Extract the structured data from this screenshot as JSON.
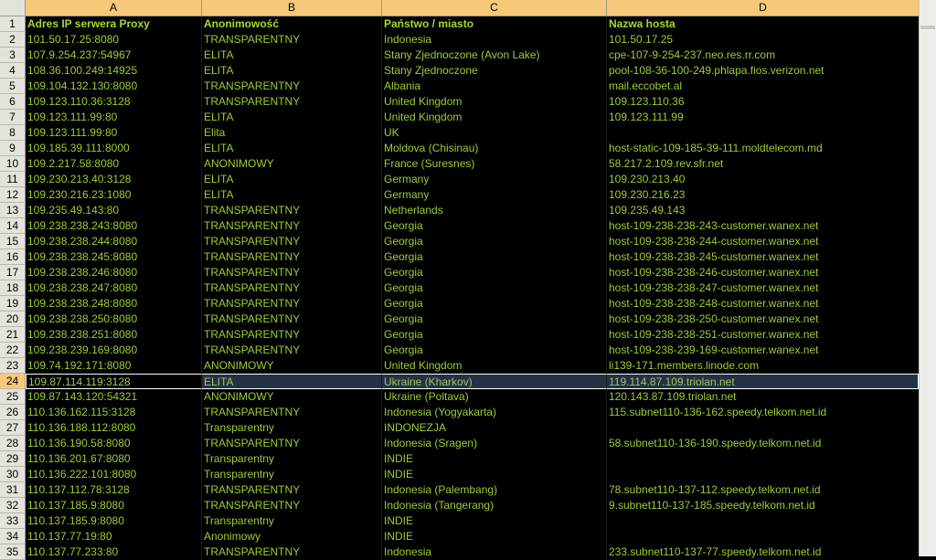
{
  "columns": [
    "A",
    "B",
    "C",
    "D"
  ],
  "header": {
    "a": "Adres IP serwera Proxy",
    "b": "Anonimowość",
    "c": "Państwo / miasto",
    "d": "Nazwa hosta"
  },
  "rows": [
    {
      "n": "2",
      "a": "101.50.17.25:8080",
      "b": "TRANSPARENTNY",
      "c": "Indonesia",
      "d": "101.50.17.25"
    },
    {
      "n": "3",
      "a": "107.9.254.237:54967",
      "b": "ELITA",
      "c": "Stany Zjednoczone (Avon Lake)",
      "d": "cpe-107-9-254-237.neo.res.rr.com"
    },
    {
      "n": "4",
      "a": "108.36.100.249:14925",
      "b": "ELITA",
      "c": "Stany Zjednoczone",
      "d": "pool-108-36-100-249.phlapa.fios.verizon.net"
    },
    {
      "n": "5",
      "a": "109.104.132.130:8080",
      "b": "TRANSPARENTNY",
      "c": "Albania",
      "d": "mail.eccobet.al"
    },
    {
      "n": "6",
      "a": "109.123.110.36:3128",
      "b": "TRANSPARENTNY",
      "c": "United Kingdom",
      "d": "109.123.110.36"
    },
    {
      "n": "7",
      "a": "109.123.111.99:80",
      "b": "ELITA",
      "c": "United Kingdom",
      "d": "109.123.111.99"
    },
    {
      "n": "8",
      "a": "109.123.111.99:80",
      "b": "Elita",
      "c": "UK",
      "d": ""
    },
    {
      "n": "9",
      "a": "109.185.39.111:8000",
      "b": "ELITA",
      "c": "Moldova (Chisinau)",
      "d": "host-static-109-185-39-111.moldtelecom.md"
    },
    {
      "n": "10",
      "a": "109.2.217.58:8080",
      "b": "ANONIMOWY",
      "c": "France (Suresnes)",
      "d": "58.217.2.109.rev.sfr.net"
    },
    {
      "n": "11",
      "a": "109.230.213.40:3128",
      "b": "ELITA",
      "c": "Germany",
      "d": "109.230.213.40"
    },
    {
      "n": "12",
      "a": "109.230.216.23:1080",
      "b": "ELITA",
      "c": "Germany",
      "d": "109.230.216.23"
    },
    {
      "n": "13",
      "a": "109.235.49.143:80",
      "b": "TRANSPARENTNY",
      "c": "Netherlands",
      "d": "109.235.49.143"
    },
    {
      "n": "14",
      "a": "109.238.238.243:8080",
      "b": "TRANSPARENTNY",
      "c": "Georgia",
      "d": "host-109-238-238-243-customer.wanex.net"
    },
    {
      "n": "15",
      "a": "109.238.238.244:8080",
      "b": "TRANSPARENTNY",
      "c": "Georgia",
      "d": "host-109-238-238-244-customer.wanex.net"
    },
    {
      "n": "16",
      "a": "109.238.238.245:8080",
      "b": "TRANSPARENTNY",
      "c": "Georgia",
      "d": "host-109-238-238-245-customer.wanex.net"
    },
    {
      "n": "17",
      "a": "109.238.238.246:8080",
      "b": "TRANSPARENTNY",
      "c": "Georgia",
      "d": "host-109-238-238-246-customer.wanex.net"
    },
    {
      "n": "18",
      "a": "109.238.238.247:8080",
      "b": "TRANSPARENTNY",
      "c": "Georgia",
      "d": "host-109-238-238-247-customer.wanex.net"
    },
    {
      "n": "19",
      "a": "109.238.238.248:8080",
      "b": "TRANSPARENTNY",
      "c": "Georgia",
      "d": "host-109-238-238-248-customer.wanex.net"
    },
    {
      "n": "20",
      "a": "109.238.238.250:8080",
      "b": "TRANSPARENTNY",
      "c": "Georgia",
      "d": "host-109-238-238-250-customer.wanex.net"
    },
    {
      "n": "21",
      "a": "109.238.238.251:8080",
      "b": "TRANSPARENTNY",
      "c": "Georgia",
      "d": "host-109-238-238-251-customer.wanex.net"
    },
    {
      "n": "22",
      "a": "109.238.239.169:8080",
      "b": "TRANSPARENTNY",
      "c": "Georgia",
      "d": "host-109-238-239-169-customer.wanex.net"
    },
    {
      "n": "23",
      "a": "109.74.192.171:8080",
      "b": "ANONIMOWY",
      "c": "United Kingdom",
      "d": "li139-171.members.linode.com"
    },
    {
      "n": "24",
      "a": "109.87.114.119:3128",
      "b": "ELITA",
      "c": "Ukraine (Kharkov)",
      "d": "119.114.87.109.triolan.net",
      "selected": true
    },
    {
      "n": "25",
      "a": "109.87.143.120:54321",
      "b": "ANONIMOWY",
      "c": "Ukraine (Poltava)",
      "d": "120.143.87.109.triolan.net"
    },
    {
      "n": "26",
      "a": "110.136.162.115:3128",
      "b": "TRANSPARENTNY",
      "c": "Indonesia (Yogyakarta)",
      "d": "115.subnet110-136-162.speedy.telkom.net.id"
    },
    {
      "n": "27",
      "a": "110.136.188.112:8080",
      "b": "Transparentny",
      "c": "INDONEZJA",
      "d": ""
    },
    {
      "n": "28",
      "a": "110.136.190.58:8080",
      "b": "TRANSPARENTNY",
      "c": "Indonesia (Sragen)",
      "d": "58.subnet110-136-190.speedy.telkom.net.id"
    },
    {
      "n": "29",
      "a": "110.136.201.67:8080",
      "b": "Transparentny",
      "c": "INDIE",
      "d": ""
    },
    {
      "n": "30",
      "a": "110.136.222.101:8080",
      "b": "Transparentny",
      "c": "INDIE",
      "d": ""
    },
    {
      "n": "31",
      "a": "110.137.112.78:3128",
      "b": "TRANSPARENTNY",
      "c": "Indonesia (Palembang)",
      "d": "78.subnet110-137-112.speedy.telkom.net.id"
    },
    {
      "n": "32",
      "a": "110.137.185.9:8080",
      "b": "TRANSPARENTNY",
      "c": "Indonesia (Tangerang)",
      "d": "9.subnet110-137-185.speedy.telkom.net.id"
    },
    {
      "n": "33",
      "a": "110.137.185.9:8080",
      "b": "Transparentny",
      "c": "INDIE",
      "d": ""
    },
    {
      "n": "34",
      "a": "110.137.77.19:80",
      "b": "Anonimowy",
      "c": "INDIE",
      "d": ""
    },
    {
      "n": "35",
      "a": "110.137.77.233:80",
      "b": "TRANSPARENTNY",
      "c": "Indonesia",
      "d": "233.subnet110-137-77.speedy.telkom.net.id"
    }
  ]
}
